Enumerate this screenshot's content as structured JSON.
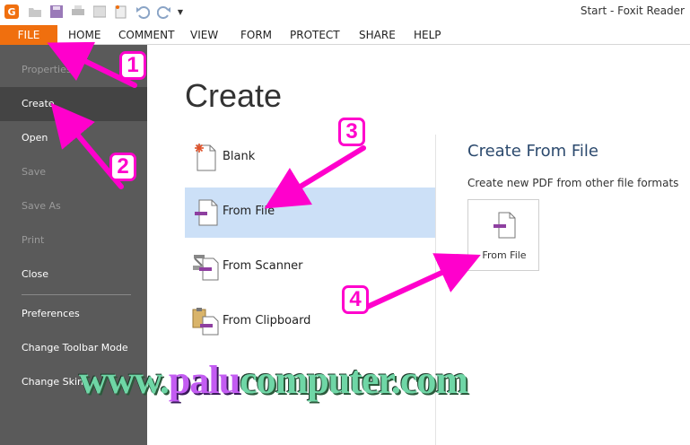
{
  "window": {
    "title": "Start - Foxit Reader"
  },
  "tabs": {
    "file": "FILE",
    "items": [
      "HOME",
      "COMMENT",
      "VIEW",
      "FORM",
      "PROTECT",
      "SHARE",
      "HELP"
    ]
  },
  "sidebar": {
    "items": [
      {
        "label": "Properties",
        "state": "disabled"
      },
      {
        "label": "Create",
        "state": "active"
      },
      {
        "label": "Open",
        "state": "normal"
      },
      {
        "label": "Save",
        "state": "disabled"
      },
      {
        "label": "Save As",
        "state": "disabled"
      },
      {
        "label": "Print",
        "state": "disabled"
      },
      {
        "label": "Close",
        "state": "normal"
      },
      {
        "label": "Preferences",
        "state": "normal"
      },
      {
        "label": "Change Toolbar Mode",
        "state": "normal"
      },
      {
        "label": "Change Skin",
        "state": "normal"
      }
    ]
  },
  "main": {
    "title": "Create",
    "options": [
      {
        "label": "Blank",
        "icon": "blank-page-icon"
      },
      {
        "label": "From File",
        "icon": "from-file-icon",
        "selected": true
      },
      {
        "label": "From Scanner",
        "icon": "scanner-icon"
      },
      {
        "label": "From Clipboard",
        "icon": "clipboard-icon"
      }
    ]
  },
  "detail": {
    "title": "Create From File",
    "description": "Create new PDF from other file formats",
    "button_label": "From File"
  },
  "annotations": {
    "badges": [
      "1",
      "2",
      "3",
      "4"
    ],
    "watermark_prefix": "www.",
    "watermark_accent": "palu",
    "watermark_suffix": "computer.com",
    "color": "#ff00cc"
  },
  "colors": {
    "accent": "#f06f0e",
    "sidebar": "#5a5a5a",
    "selected": "#cce0f7"
  }
}
